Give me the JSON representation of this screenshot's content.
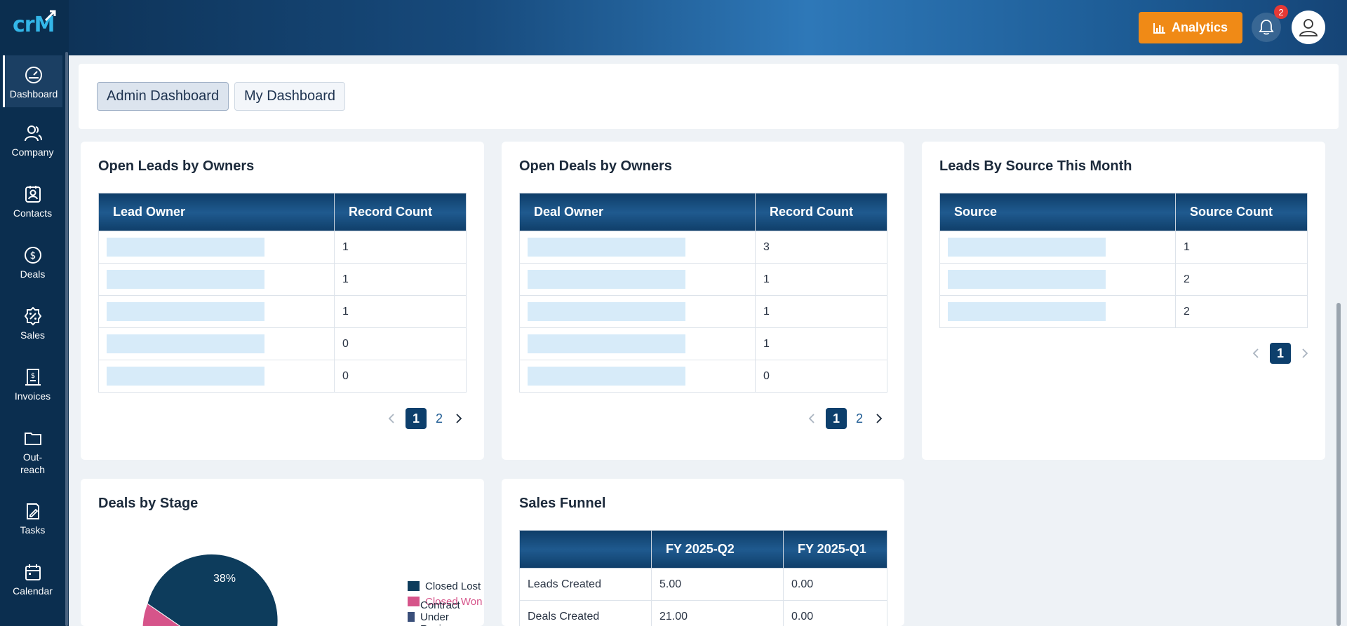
{
  "app": {
    "logo_text": "crM"
  },
  "header": {
    "analytics_label": "Analytics",
    "notification_count": "2"
  },
  "sidebar": {
    "items": [
      {
        "label": "Dashboard",
        "icon": "gauge-icon"
      },
      {
        "label": "Company",
        "icon": "users-icon"
      },
      {
        "label": "Contacts",
        "icon": "contact-card-icon"
      },
      {
        "label": "Deals",
        "icon": "dollar-coin-icon"
      },
      {
        "label": "Sales",
        "icon": "percent-badge-icon"
      },
      {
        "label": "Invoices",
        "icon": "invoice-icon"
      },
      {
        "label": "Out-",
        "label2": "reach",
        "icon": "folder-icon"
      },
      {
        "label": "Tasks",
        "icon": "task-pen-icon"
      },
      {
        "label": "Calendar",
        "icon": "calendar-icon"
      }
    ]
  },
  "tabs": {
    "admin": "Admin Dashboard",
    "mine": "My Dashboard"
  },
  "leads_owners": {
    "title": "Open Leads by Owners",
    "headers": [
      "Lead Owner",
      "Record Count"
    ],
    "counts": [
      "1",
      "1",
      "1",
      "0",
      "0"
    ],
    "pages": [
      "1",
      "2"
    ]
  },
  "deals_owners": {
    "title": "Open Deals by Owners",
    "headers": [
      "Deal Owner",
      "Record Count"
    ],
    "counts": [
      "3",
      "1",
      "1",
      "1",
      "0"
    ],
    "pages": [
      "1",
      "2"
    ]
  },
  "leads_source": {
    "title": "Leads By Source This Month",
    "headers": [
      "Source",
      "Source Count"
    ],
    "counts": [
      "1",
      "2",
      "2"
    ],
    "pages": [
      "1"
    ]
  },
  "deals_stage": {
    "title": "Deals by Stage",
    "slice_label": "38%",
    "legend": [
      {
        "name": "Closed Lost",
        "color": "#0d3c5c"
      },
      {
        "name": "Closed Won",
        "color": "#d6548a"
      },
      {
        "name": "Contract Under Review",
        "color": "#3a4f7a"
      }
    ]
  },
  "funnel": {
    "title": "Sales Funnel",
    "headers": [
      "",
      "FY 2025-Q2",
      "FY 2025-Q1"
    ],
    "rows": [
      [
        "Leads Created",
        "5.00",
        "0.00"
      ],
      [
        "Deals Created",
        "21.00",
        "0.00"
      ]
    ]
  },
  "colors": {
    "accent": "#f08a16",
    "nav": "#0b2e4f",
    "header_table": "#0f3e69",
    "badge": "#e53935"
  }
}
